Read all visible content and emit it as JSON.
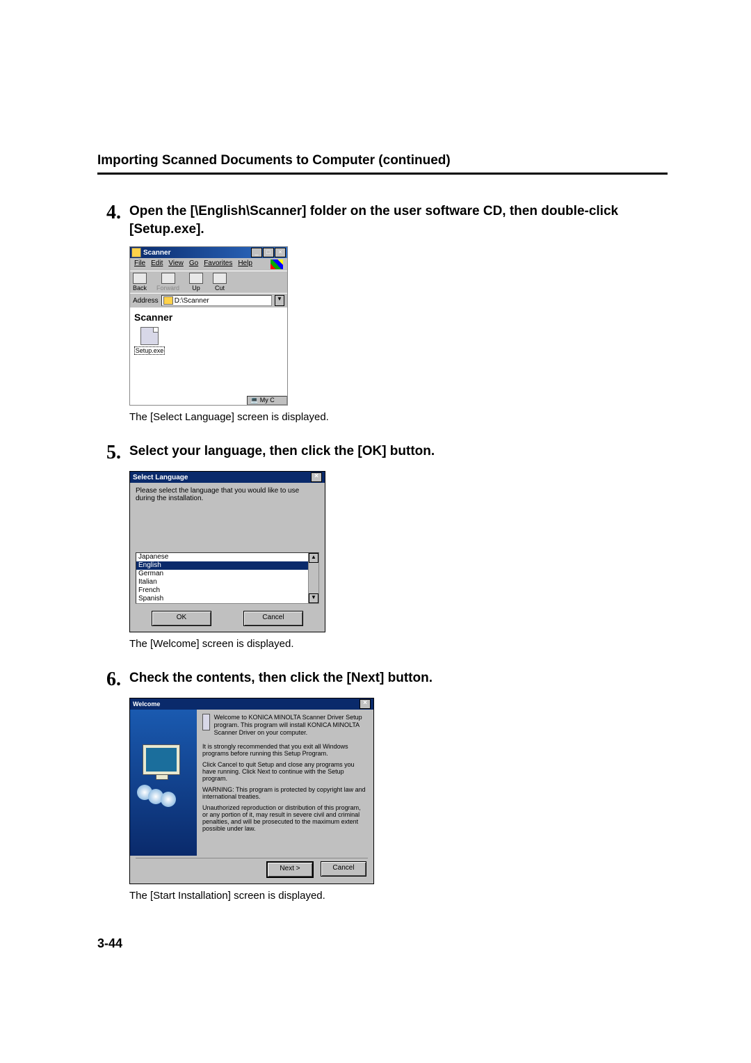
{
  "header": "Importing Scanned Documents to Computer (continued)",
  "page_number": "3-44",
  "steps": {
    "s4": {
      "num": "4.",
      "title": "Open the [\\English\\Scanner] folder on the user software CD, then double-click [Setup.exe].",
      "note": "The [Select Language] screen is displayed."
    },
    "s5": {
      "num": "5.",
      "title": "Select your language, then click the [OK] button.",
      "note": "The [Welcome] screen is displayed."
    },
    "s6": {
      "num": "6.",
      "title": "Check the contents, then click the [Next] button.",
      "note": "The [Start Installation] screen is displayed."
    }
  },
  "explorer": {
    "title": "Scanner",
    "menus": {
      "file": "File",
      "edit": "Edit",
      "view": "View",
      "go": "Go",
      "favorites": "Favorites",
      "help": "Help"
    },
    "toolbar": {
      "back": "Back",
      "forward": "Forward",
      "up": "Up",
      "cut": "Cut"
    },
    "address_label": "Address",
    "address_value": "D:\\Scanner",
    "heading": "Scanner",
    "file_label": "Setup.exe",
    "status": "My C"
  },
  "selectlang": {
    "title": "Select Language",
    "prompt": "Please select the language that you would like to use during the installation.",
    "items": {
      "i0": "Japanese",
      "i1": "English",
      "i2": "German",
      "i3": "Italian",
      "i4": "French",
      "i5": "Spanish"
    },
    "ok": "OK",
    "cancel": "Cancel"
  },
  "welcome": {
    "title": "Welcome",
    "head": "Welcome to KONICA MINOLTA Scanner Driver Setup program. This program will install KONICA MINOLTA Scanner Driver on your computer.",
    "p1": "It is strongly recommended that you exit all Windows programs before running this Setup Program.",
    "p2": "Click Cancel to quit Setup and close any programs you have running. Click Next to continue with the Setup program.",
    "p3": "WARNING: This program is protected by copyright law and international treaties.",
    "p4": "Unauthorized reproduction or distribution of this program, or any portion of it, may result in severe civil and criminal penalties, and will be prosecuted to the maximum extent possible under law.",
    "next": "Next >",
    "cancel": "Cancel"
  }
}
